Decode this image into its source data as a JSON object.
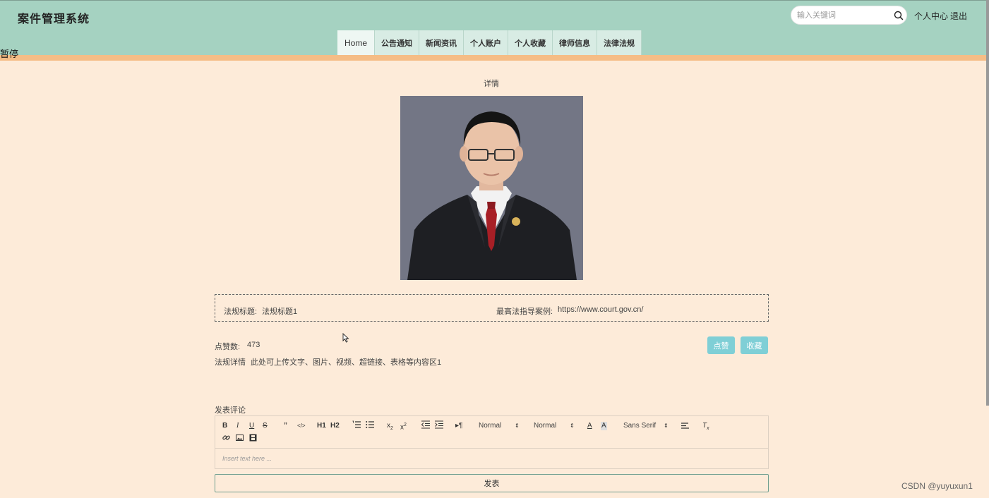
{
  "app": {
    "title": "案件管理系统"
  },
  "search": {
    "placeholder": "输入关键词"
  },
  "user_links": {
    "profile": "个人中心",
    "logout": "退出"
  },
  "nav": {
    "items": [
      "Home",
      "公告通知",
      "新闻资讯",
      "个人账户",
      "个人收藏",
      "律师信息",
      "法律法规"
    ],
    "active": "Home"
  },
  "overlay": {
    "text": "暂停"
  },
  "detail": {
    "heading": "详情",
    "title_label": "法规标题:",
    "title_value": "法规标题1",
    "guide_label": "最高法指导案例:",
    "guide_value": "https://www.court.gov.cn/",
    "likes_label": "点赞数:",
    "likes_value": "473",
    "desc_label": "法规详情",
    "desc_value": "此处可上传文字、图片、视频、超链接、表格等内容区1",
    "like_button": "点赞",
    "favorite_button": "收藏"
  },
  "comment": {
    "label": "发表评论",
    "toolbar": {
      "header1": "H1",
      "header2": "H2",
      "size": "Normal",
      "header": "Normal",
      "font": "Sans Serif"
    },
    "placeholder": "Insert text here ...",
    "submit": "发表"
  },
  "watermark": "CSDN @yuyuxun1",
  "colors": {
    "header_bg": "#a5d2c1",
    "page_bg": "#fdebd9",
    "stripe": "#f5bd86",
    "button": "#7fcfd6"
  }
}
